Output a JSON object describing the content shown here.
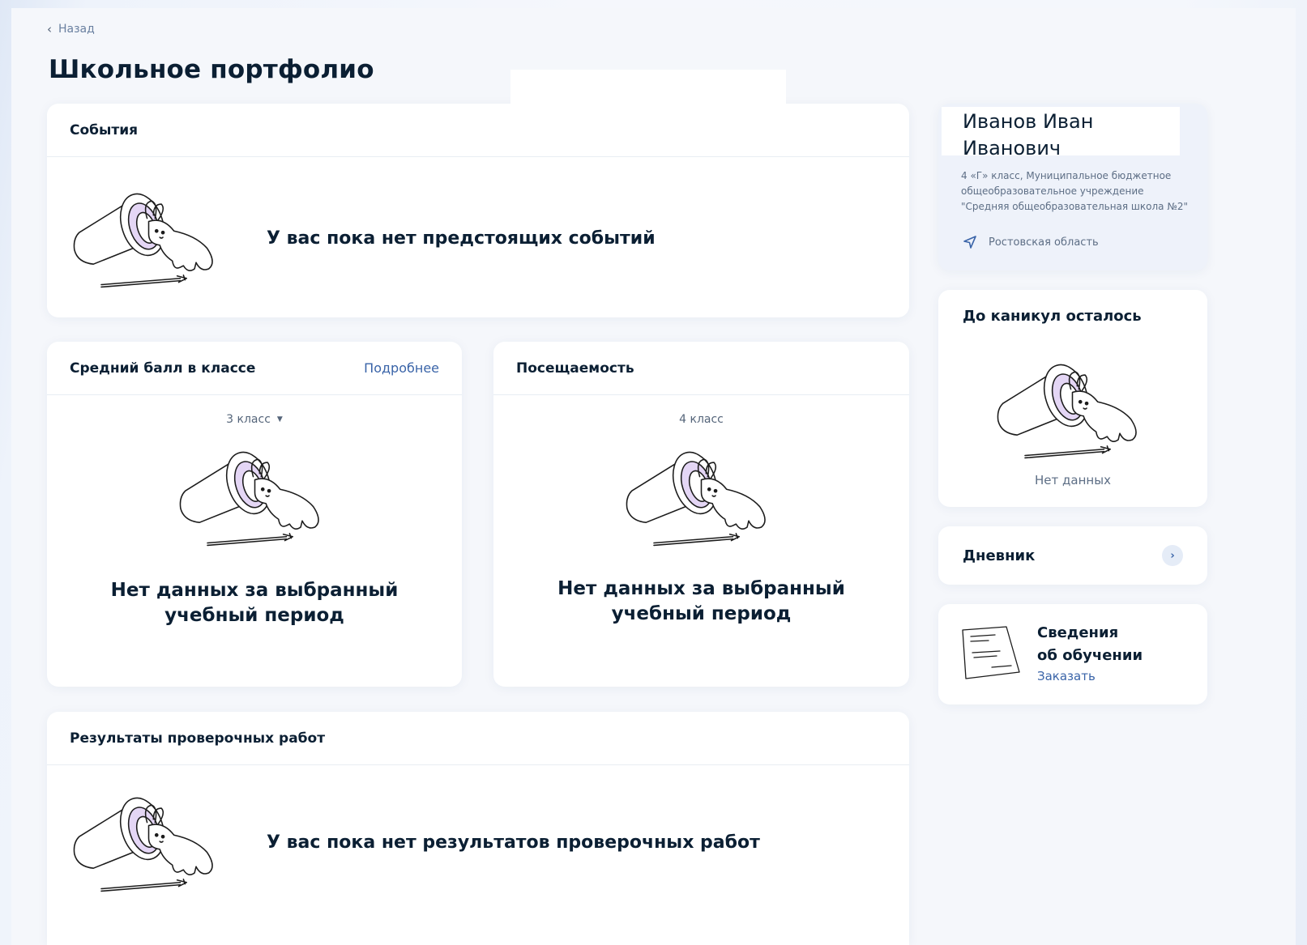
{
  "nav": {
    "back_label": "Назад"
  },
  "page": {
    "title": "Школьное портфолио"
  },
  "events": {
    "title": "События",
    "empty_text": "У вас пока нет предстоящих событий"
  },
  "avg_grade": {
    "title": "Средний балл в классе",
    "details_link": "Подробнее",
    "period": "3 класс",
    "empty_line1": "Нет данных за выбранный",
    "empty_line2": "учебный период"
  },
  "attendance": {
    "title": "Посещаемость",
    "period": "4 класс",
    "empty_line1": "Нет данных за выбранный",
    "empty_line2": "учебный период"
  },
  "tests": {
    "title": "Результаты проверочных работ",
    "empty_text": "У вас пока нет результатов проверочных работ"
  },
  "profile": {
    "name_line1": "Иванов Иван",
    "name_line2": "Иванович",
    "school": "4 «Г» класс, Муниципальное бюджетное общеобразовательное учреждение \"Средняя общеобразовательная школа №2\"",
    "region": "Ростовская область"
  },
  "vacation": {
    "title": "До каникул осталось",
    "empty_text": "Нет данных"
  },
  "diary": {
    "title": "Дневник"
  },
  "education_info": {
    "title_line1": "Сведения",
    "title_line2": "об обучении",
    "action": "Заказать"
  },
  "icons": {
    "back": "chevron-left-icon",
    "period_dropdown": "caret-down-icon",
    "location": "location-arrow-icon",
    "diary_open": "chevron-right-icon",
    "document": "document-icon",
    "empty_state": "magic-hat-rabbit-illustration"
  },
  "colors": {
    "text": "#0b1f33",
    "link": "#3a64a8",
    "muted": "#5d6e85",
    "card": "#ffffff",
    "background": "#f5f7fb",
    "illustration_accent": "#e4d6f5"
  }
}
